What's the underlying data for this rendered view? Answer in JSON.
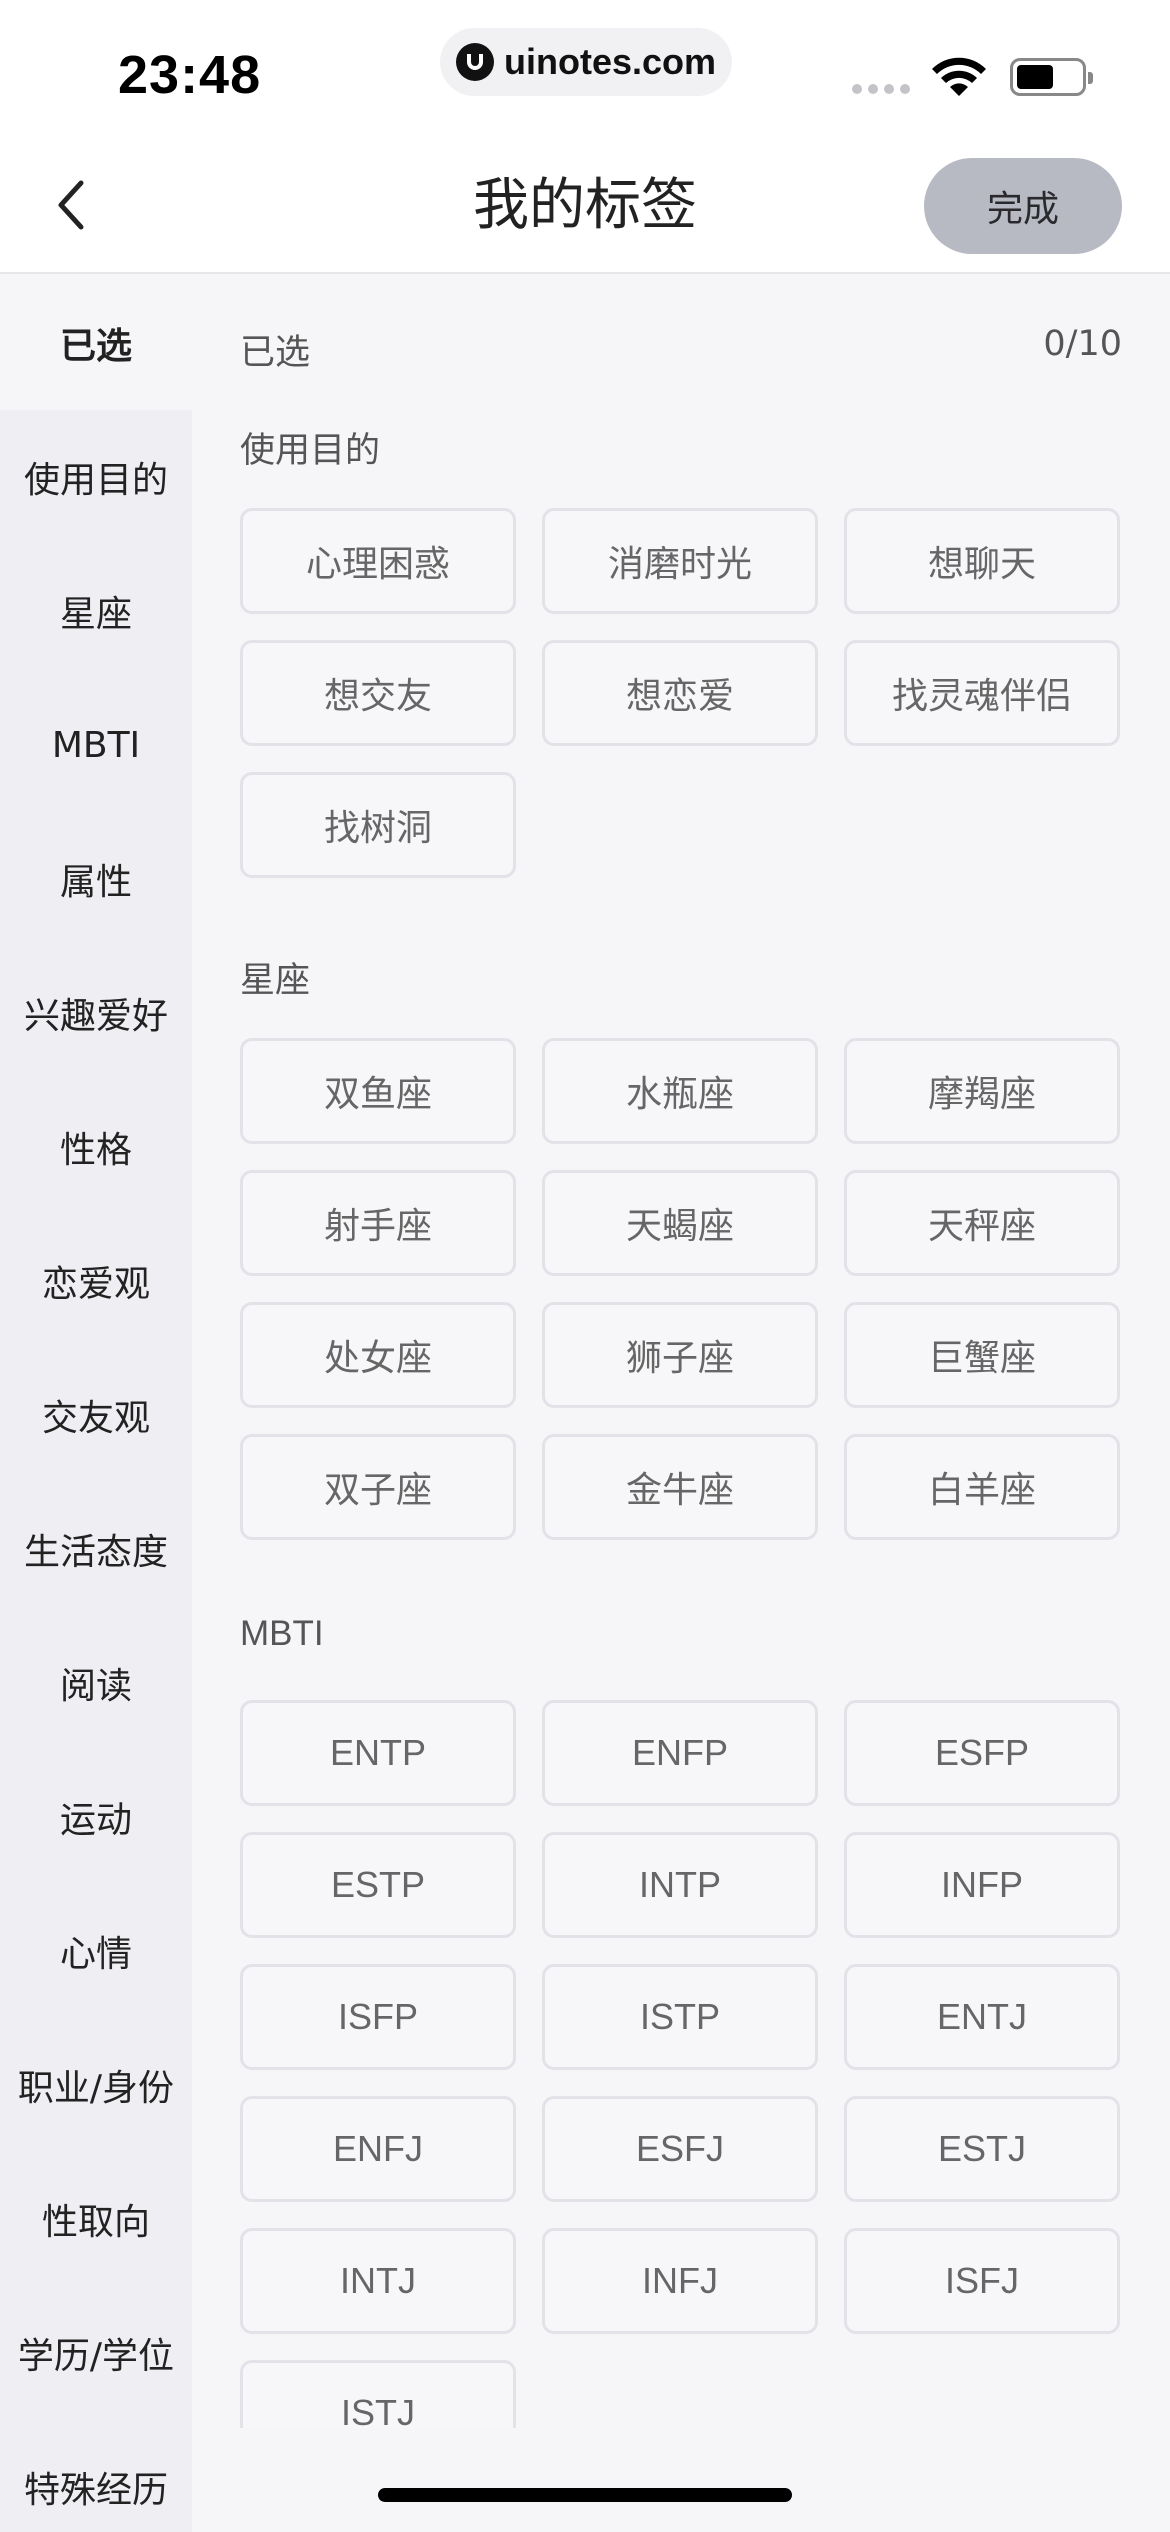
{
  "status": {
    "time": "23:48",
    "url": "uinotes.com"
  },
  "nav": {
    "title": "我的标签",
    "done_label": "完成"
  },
  "sidebar": {
    "items": [
      "已选",
      "使用目的",
      "星座",
      "MBTI",
      "属性",
      "兴趣爱好",
      "性格",
      "恋爱观",
      "交友观",
      "生活态度",
      "阅读",
      "运动",
      "心情",
      "职业/身份",
      "性取向",
      "学历/学位",
      "特殊经历"
    ],
    "active": "已选"
  },
  "selected": {
    "label": "已选",
    "count": "0/10"
  },
  "sections": [
    {
      "title": "使用目的",
      "tags": [
        "心理困惑",
        "消磨时光",
        "想聊天",
        "想交友",
        "想恋爱",
        "找灵魂伴侣",
        "找树洞"
      ]
    },
    {
      "title": "星座",
      "tags": [
        "双鱼座",
        "水瓶座",
        "摩羯座",
        "射手座",
        "天蝎座",
        "天秤座",
        "处女座",
        "狮子座",
        "巨蟹座",
        "双子座",
        "金牛座",
        "白羊座"
      ]
    },
    {
      "title": "MBTI",
      "tags": [
        "ENTP",
        "ENFP",
        "ESFP",
        "ESTP",
        "INTP",
        "INFP",
        "ISFP",
        "ISTP",
        "ENTJ",
        "ENFJ",
        "ESFJ",
        "ESTJ",
        "INTJ",
        "INFJ",
        "ISFJ",
        "ISTJ"
      ]
    }
  ],
  "icons": {
    "back": "chevron-left-icon",
    "wifi": "wifi-icon",
    "battery": "battery-icon"
  },
  "colors": {
    "done_button": "#b8bac3",
    "sidebar_bg": "#efeff3",
    "tag_border": "#e2e2e8"
  }
}
